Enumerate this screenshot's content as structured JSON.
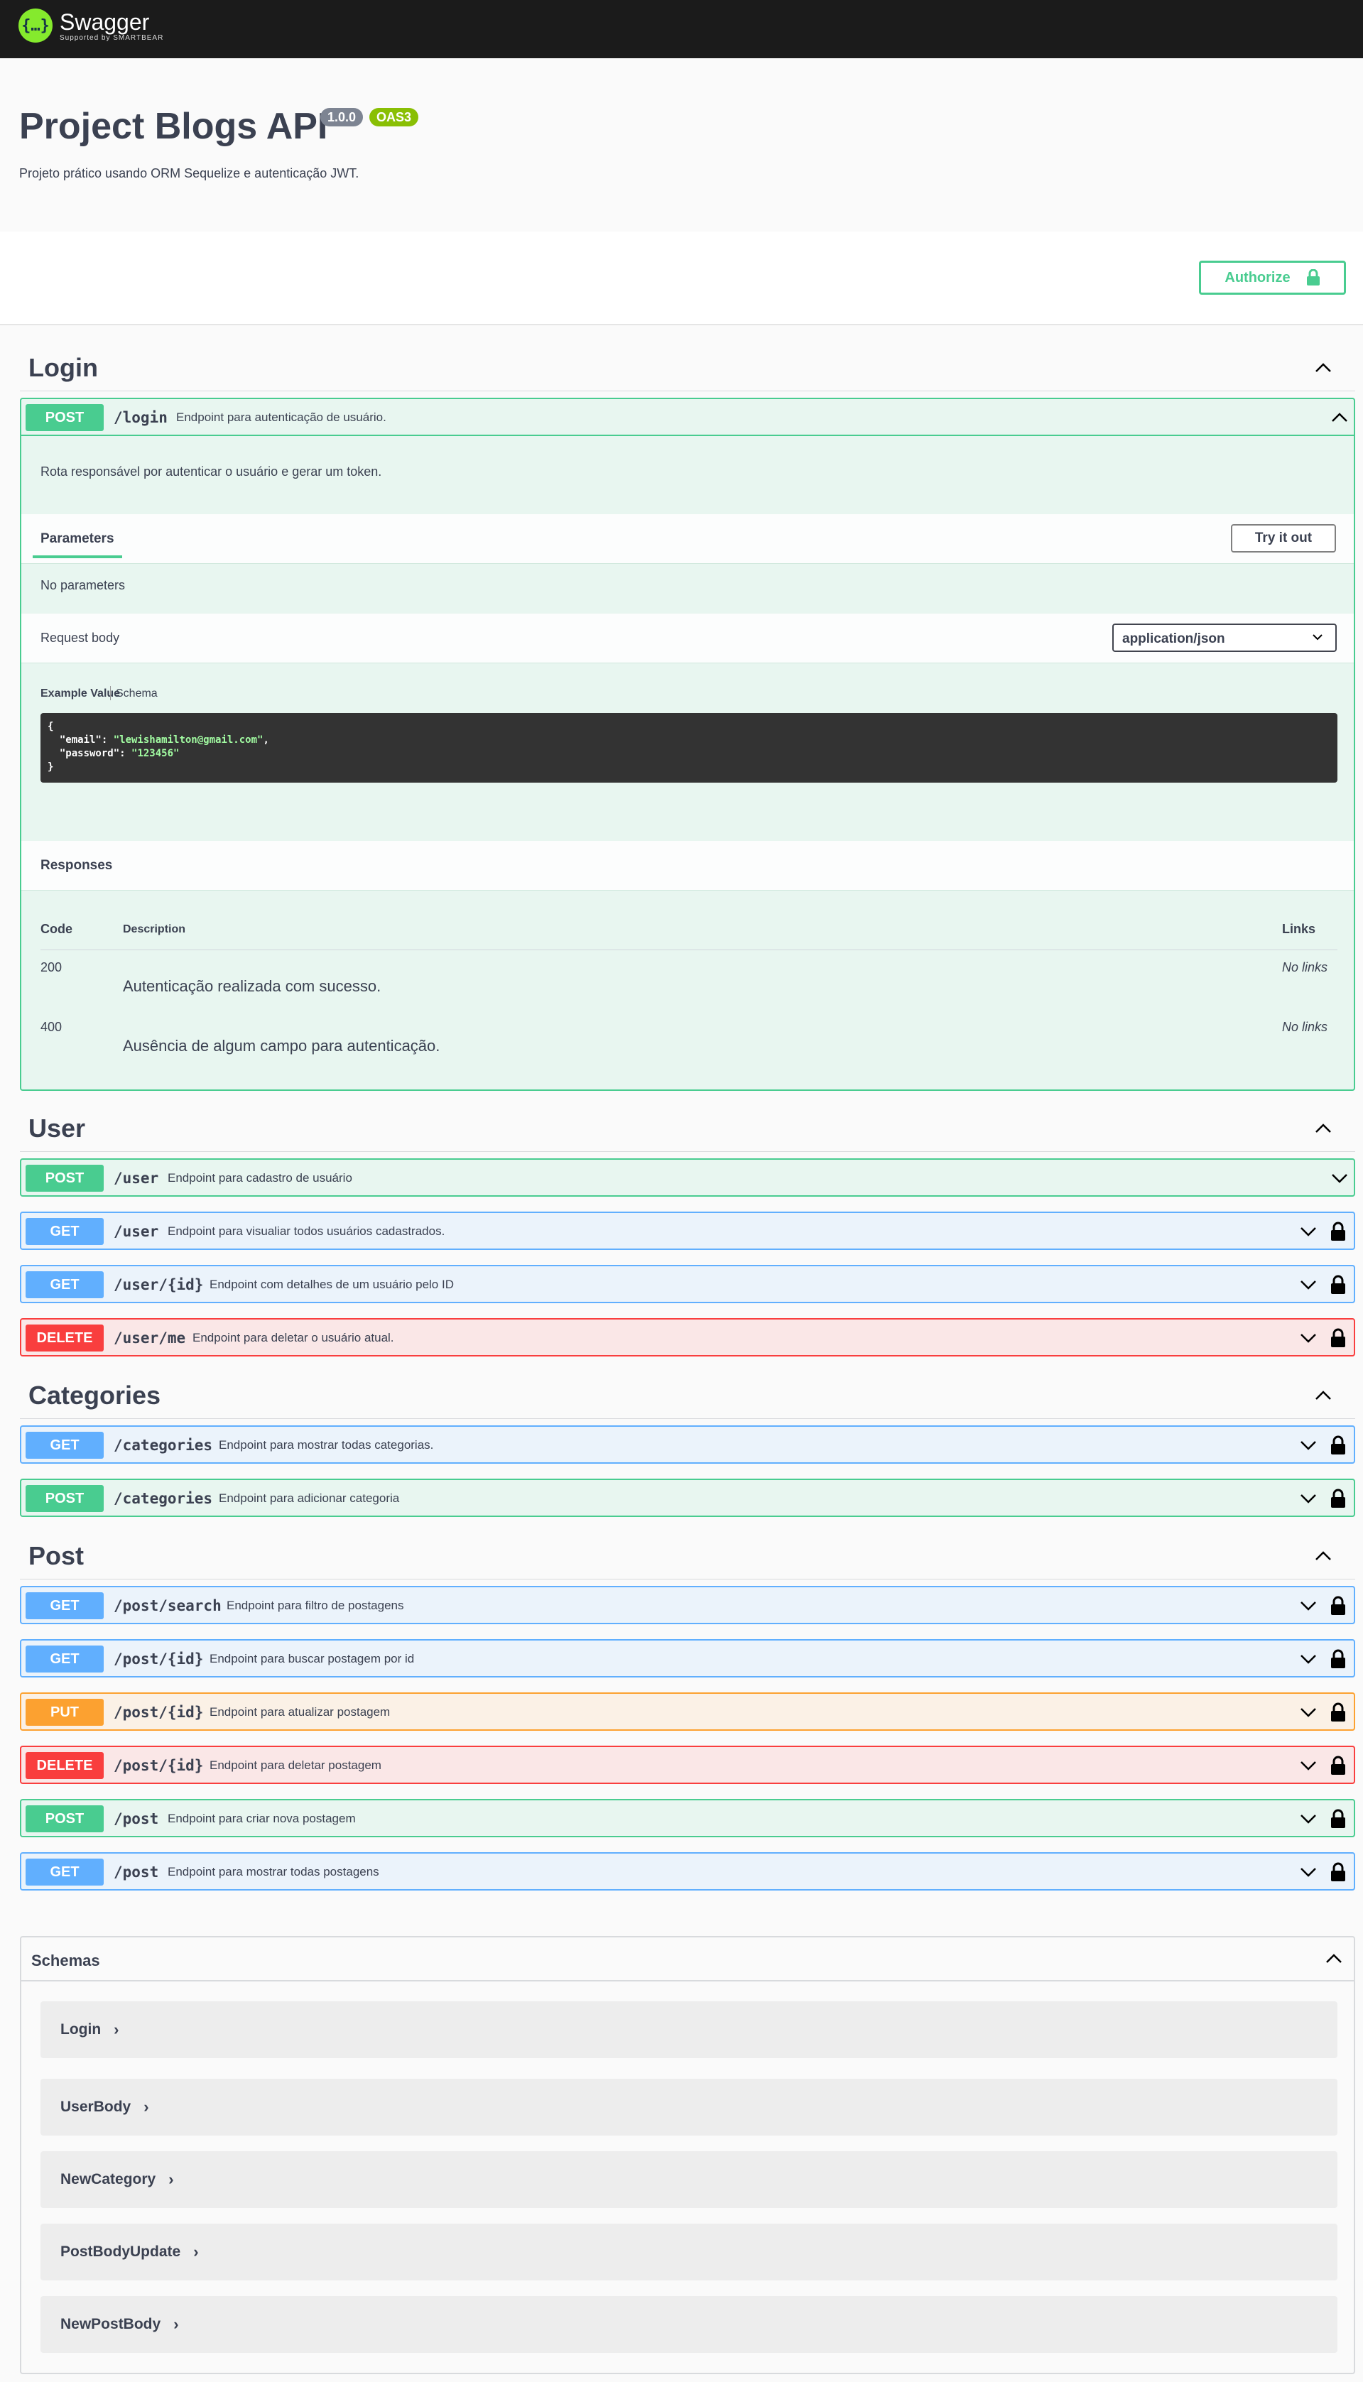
{
  "topbar": {
    "logo_glyph": "{…}",
    "logo_title": "Swagger",
    "logo_sub": "Supported by SMARTBEAR"
  },
  "info": {
    "title": "Project Blogs API",
    "version": "1.0.0",
    "oas": "OAS3",
    "description": "Projeto prático usando ORM Sequelize e autenticação JWT."
  },
  "authorize": {
    "label": "Authorize",
    "icon": "lock-icon"
  },
  "tags": {
    "login": "Login",
    "user": "User",
    "categories": "Categories",
    "post": "Post"
  },
  "login_op": {
    "method": "POST",
    "path": "/login",
    "summary": "Endpoint para autenticação de usuário.",
    "description": "Rota responsável por autenticar o usuário e gerar um token.",
    "parameters_tab": "Parameters",
    "try_it_out": "Try it out",
    "no_parameters": "No parameters",
    "request_body": "Request body",
    "content_type": "application/json",
    "example_value": "Example Value",
    "schema": "Schema",
    "example_open": "{",
    "example_email_key": "\"email\"",
    "example_email_val": "\"lewishamilton@gmail.com\"",
    "example_pass_key": "\"password\"",
    "example_pass_val": "\"123456\"",
    "example_close": "}",
    "responses": "Responses",
    "col_code": "Code",
    "col_desc": "Description",
    "col_links": "Links",
    "rows": [
      {
        "code": "200",
        "description": "Autenticação realizada com sucesso.",
        "links": "No links"
      },
      {
        "code": "400",
        "description": "Ausência de algum campo para autenticação.",
        "links": "No links"
      }
    ]
  },
  "user_ops": [
    {
      "method": "POST",
      "path": "/user",
      "summary": "Endpoint para cadastro de usuário"
    },
    {
      "method": "GET",
      "path": "/user",
      "summary": "Endpoint para visualiar todos usuários cadastrados."
    },
    {
      "method": "GET",
      "path": "/user/{id}",
      "summary": "Endpoint com detalhes de um usuário pelo ID"
    },
    {
      "method": "DELETE",
      "path": "/user/me",
      "summary": "Endpoint para deletar o usuário atual."
    }
  ],
  "category_ops": [
    {
      "method": "GET",
      "path": "/categories",
      "summary": "Endpoint para mostrar todas categorias."
    },
    {
      "method": "POST",
      "path": "/categories",
      "summary": "Endpoint para adicionar categoria"
    }
  ],
  "post_ops": [
    {
      "method": "GET",
      "path": "/post/search",
      "summary": "Endpoint para filtro de postagens"
    },
    {
      "method": "GET",
      "path": "/post/{id}",
      "summary": "Endpoint para buscar postagem por id"
    },
    {
      "method": "PUT",
      "path": "/post/{id}",
      "summary": "Endpoint para atualizar postagem"
    },
    {
      "method": "DELETE",
      "path": "/post/{id}",
      "summary": "Endpoint para deletar postagem"
    },
    {
      "method": "POST",
      "path": "/post",
      "summary": "Endpoint para criar nova postagem"
    },
    {
      "method": "GET",
      "path": "/post",
      "summary": "Endpoint para mostrar todas postagens"
    }
  ],
  "schemas": {
    "title": "Schemas",
    "models": [
      "Login",
      "UserBody",
      "NewCategory",
      "PostBodyUpdate",
      "NewPostBody"
    ]
  },
  "colors": {
    "post": "#49cc90",
    "get": "#61affe",
    "put": "#fca130",
    "delete": "#f93e3e",
    "brand": "#85ea2d"
  }
}
